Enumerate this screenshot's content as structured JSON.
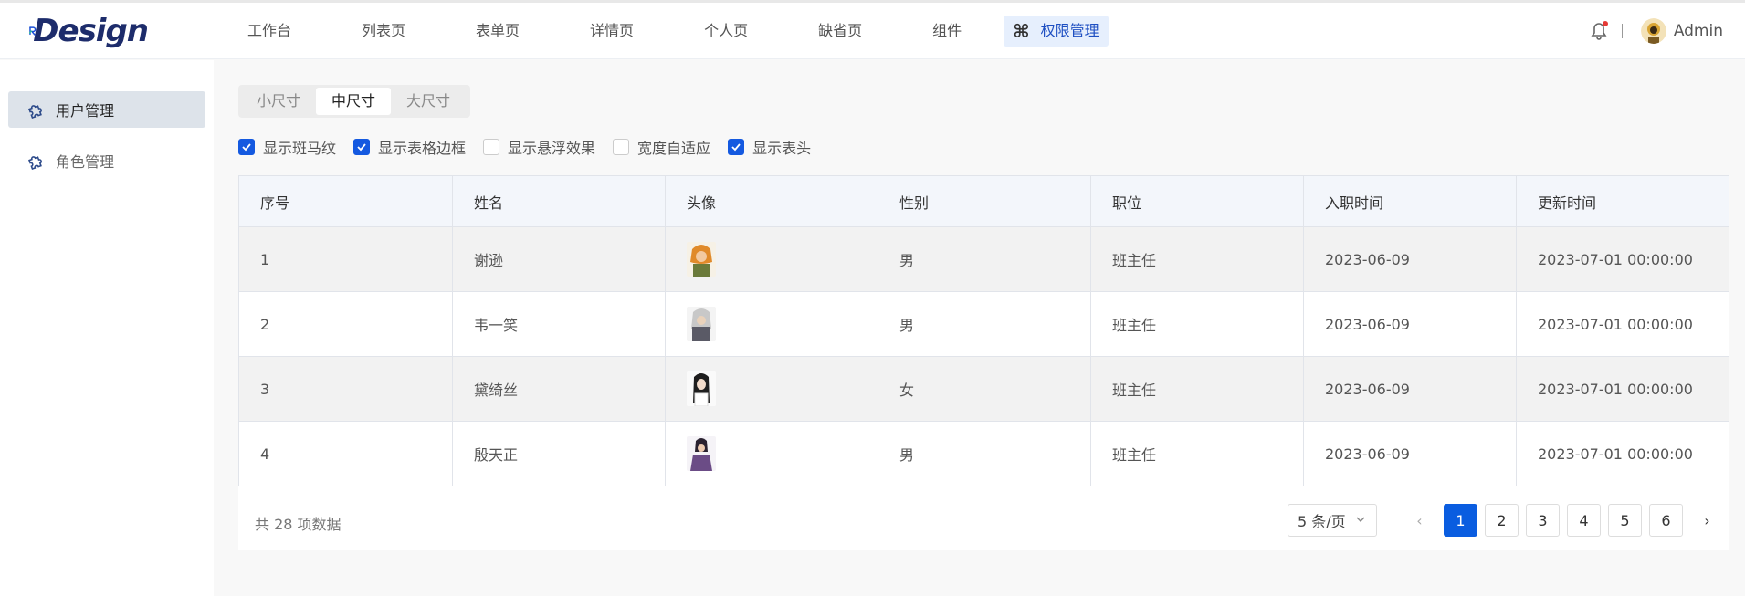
{
  "header": {
    "logo_text": "Design",
    "nav": [
      {
        "label": "工作台"
      },
      {
        "label": "列表页"
      },
      {
        "label": "表单页"
      },
      {
        "label": "详情页"
      },
      {
        "label": "个人页"
      },
      {
        "label": "缺省页"
      },
      {
        "label": "组件"
      }
    ],
    "active_nav": {
      "icon": "⌘",
      "label": "权限管理"
    },
    "user": "Admin"
  },
  "sidebar": {
    "items": [
      {
        "label": "用户管理",
        "active": true
      },
      {
        "label": "角色管理",
        "active": false
      }
    ]
  },
  "sizes": [
    "小尺寸",
    "中尺寸",
    "大尺寸"
  ],
  "active_size": "中尺寸",
  "options": [
    {
      "label": "显示斑马纹",
      "checked": true
    },
    {
      "label": "显示表格边框",
      "checked": true
    },
    {
      "label": "显示悬浮效果",
      "checked": false
    },
    {
      "label": "宽度自适应",
      "checked": false
    },
    {
      "label": "显示表头",
      "checked": true
    }
  ],
  "table": {
    "columns": [
      "序号",
      "姓名",
      "头像",
      "性别",
      "职位",
      "入职时间",
      "更新时间"
    ],
    "rows": [
      {
        "no": "1",
        "name": "谢逊",
        "gender": "男",
        "position": "班主任",
        "hire": "2023-06-09",
        "updated": "2023-07-01 00:00:00"
      },
      {
        "no": "2",
        "name": "韦一笑",
        "gender": "男",
        "position": "班主任",
        "hire": "2023-06-09",
        "updated": "2023-07-01 00:00:00"
      },
      {
        "no": "3",
        "name": "黛绮丝",
        "gender": "女",
        "position": "班主任",
        "hire": "2023-06-09",
        "updated": "2023-07-01 00:00:00"
      },
      {
        "no": "4",
        "name": "殷天正",
        "gender": "男",
        "position": "班主任",
        "hire": "2023-06-09",
        "updated": "2023-07-01 00:00:00"
      }
    ]
  },
  "pagination": {
    "total": "共 28 项数据",
    "page_size": "5 条/页",
    "pages": [
      "1",
      "2",
      "3",
      "4",
      "5",
      "6"
    ],
    "current": "1",
    "prev": "‹",
    "next": "›"
  },
  "colors": {
    "primary": "#0a5de0",
    "nav_active_bg": "#e6effd",
    "zebra": "#f2f2f2"
  }
}
